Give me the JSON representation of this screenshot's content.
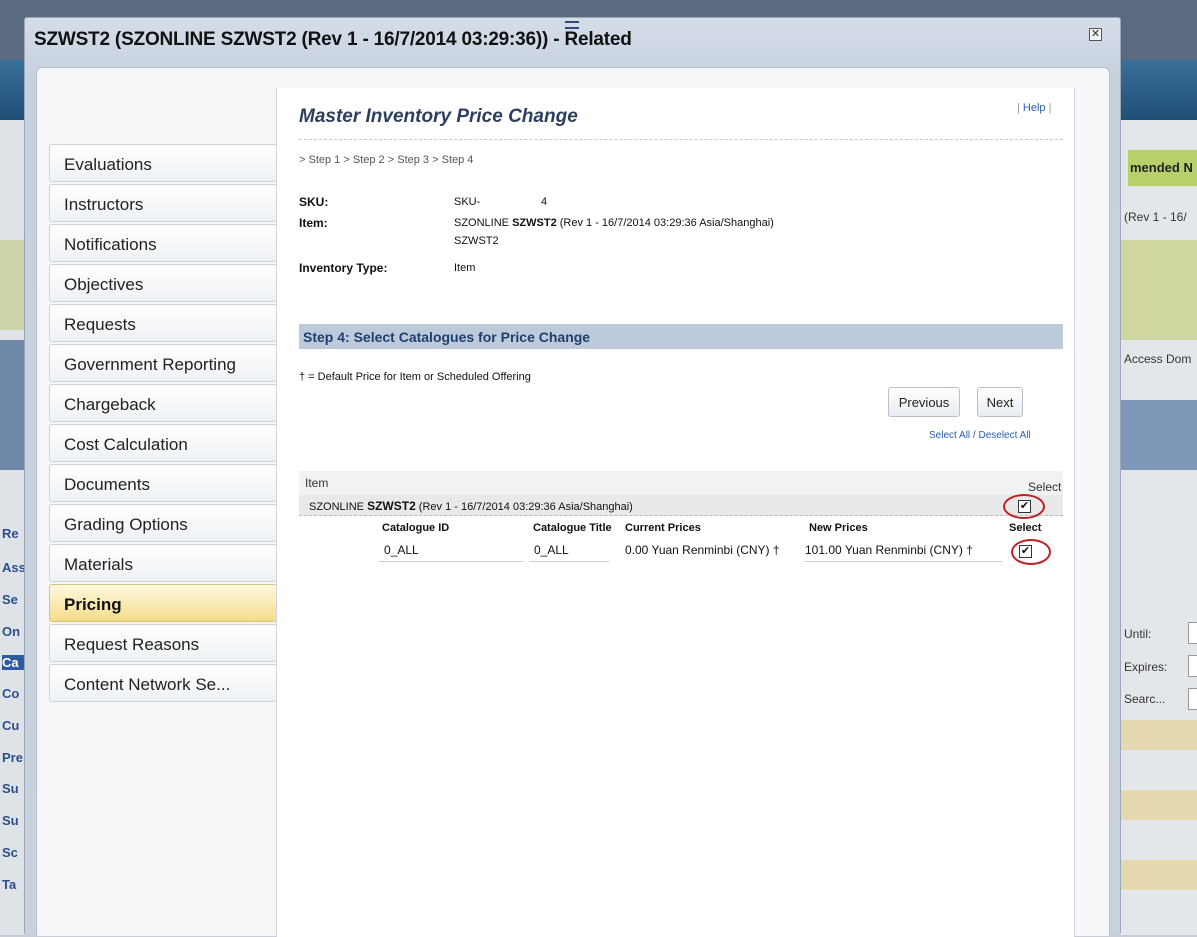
{
  "background": {
    "right_tab": "mended N",
    "right_rev": "(Rev 1 - 16/",
    "right_access": "Access Dom",
    "right_until": "Until:",
    "right_expires": "Expires:",
    "right_search": "Searc...",
    "left_links": [
      "Re",
      "Ass",
      "Se",
      "On",
      "Ca",
      "Co",
      "Cu",
      "Pre",
      "Su",
      "Su",
      "Sc",
      "Ta"
    ]
  },
  "modal": {
    "title": "SZWST2 (SZONLINE SZWST2 (Rev 1 - 16/7/2014 03:29:36)) - Related",
    "close_glyph": "✕"
  },
  "nav": {
    "items": [
      {
        "label": "Evaluations"
      },
      {
        "label": "Instructors"
      },
      {
        "label": "Notifications"
      },
      {
        "label": "Objectives"
      },
      {
        "label": "Requests"
      },
      {
        "label": "Government Reporting"
      },
      {
        "label": "Chargeback"
      },
      {
        "label": "Cost Calculation"
      },
      {
        "label": "Documents"
      },
      {
        "label": "Grading Options"
      },
      {
        "label": "Materials"
      },
      {
        "label": "Pricing",
        "active": true
      },
      {
        "label": "Request Reasons"
      },
      {
        "label": "Content Network Se..."
      }
    ]
  },
  "page": {
    "title": "Master Inventory Price Change",
    "help": "Help",
    "breadcrumb": [
      "Step 1",
      "Step 2",
      "Step 3",
      "Step 4"
    ],
    "breadcrumb_sep": ">",
    "sku_label": "SKU:",
    "sku_prefix": "SKU-",
    "sku_value": "4",
    "item_label": "Item:",
    "item_value_pre": "SZONLINE ",
    "item_value_bold": "SZWST2",
    "item_value_post": " (Rev 1 - 16/7/2014 03:29:36 Asia/Shanghai)",
    "item_value_line2": "SZWST2",
    "inventory_type_label": "Inventory Type:",
    "inventory_type_value": "Item",
    "section_title": "Step 4: Select Catalogues for Price Change",
    "legend": "†  = Default Price for Item or Scheduled Offering",
    "previous_button": "Previous",
    "next_button": "Next",
    "select_all": "Select All",
    "select_sep": " / ",
    "deselect_all": "Deselect All"
  },
  "table": {
    "header_item": "Item",
    "header_select": "Select",
    "row_pre": "SZONLINE ",
    "row_bold": "SZWST2",
    "row_post": " (Rev 1 - 16/7/2014 03:29:36 Asia/Shanghai)",
    "row_checked": true,
    "sub_headers": {
      "catalogue_id": "Catalogue ID",
      "catalogue_title": "Catalogue Title",
      "current_prices": "Current Prices",
      "new_prices": "New Prices",
      "select": "Select"
    },
    "rows": [
      {
        "catalogue_id": "0_ALL",
        "catalogue_title": "0_ALL",
        "current_price": "0.00 Yuan Renminbi (CNY) †",
        "new_price": "101.00 Yuan Renminbi (CNY) †",
        "checked": true
      }
    ],
    "check_glyph": "✔"
  },
  "colors": {
    "active_nav": "#f4dc8a",
    "section_bar": "#bccadb",
    "title_text": "#2e3f5e",
    "link": "#2a5db0",
    "annotation": "#c21f24"
  }
}
